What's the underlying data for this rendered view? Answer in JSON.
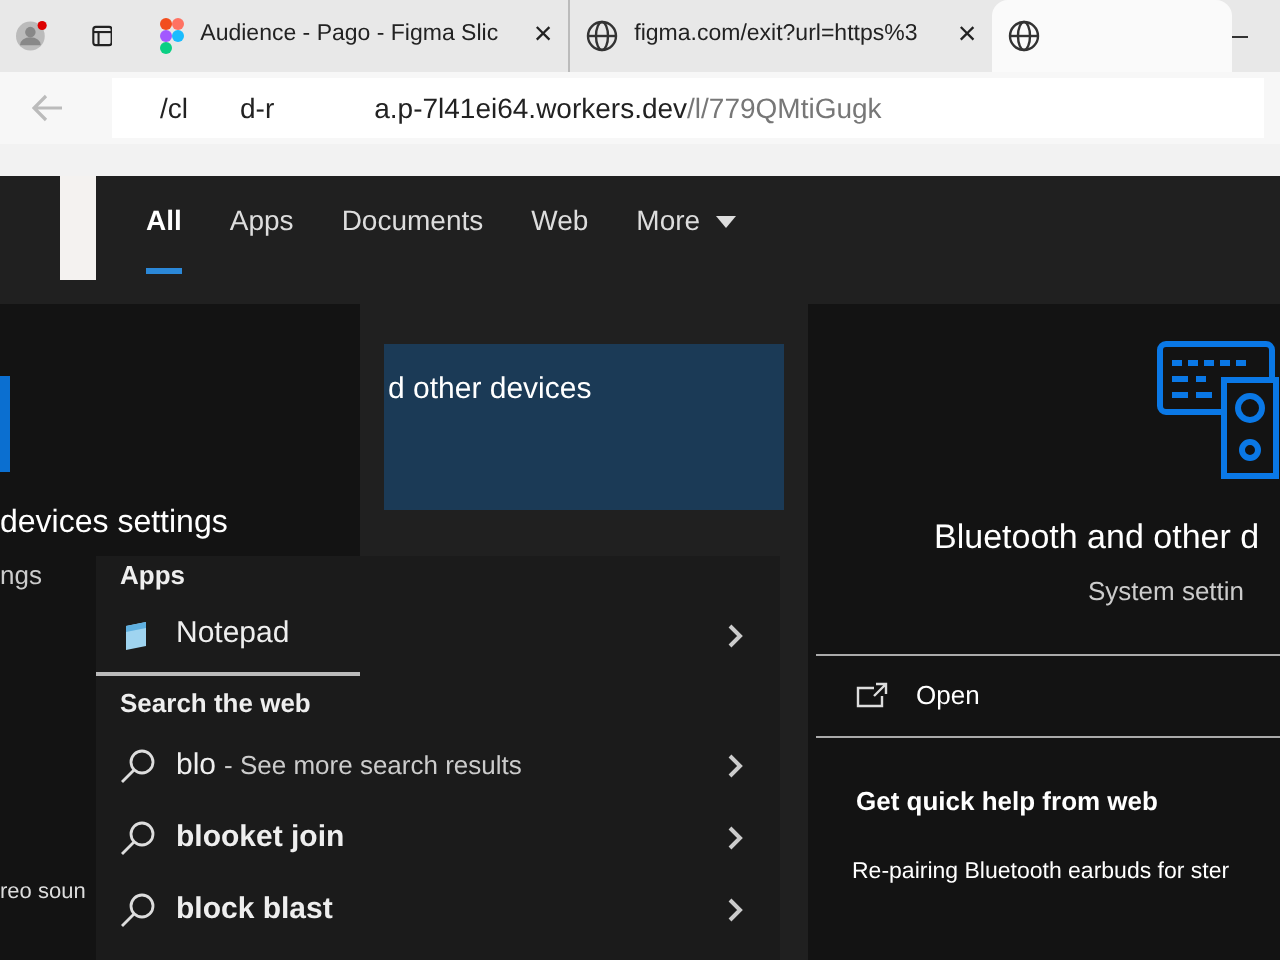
{
  "browser": {
    "tabs": [
      {
        "kind": "figma",
        "title": "Audience - Pago - Figma Slic",
        "close": "×",
        "selected": false
      },
      {
        "kind": "globe",
        "title": "figma.com/exit?url=https%3",
        "close": "×",
        "selected": false
      },
      {
        "kind": "globe",
        "selected": true
      }
    ],
    "address_bar": {
      "fragments": [
        "/cl",
        "d-r"
      ],
      "host": "a.p-7l41ei64.workers.dev",
      "path": "/l/779QMtiGugk"
    }
  },
  "search_tabs": [
    {
      "label": "All",
      "selected": true,
      "kind": "tab"
    },
    {
      "label": "Apps",
      "selected": false,
      "kind": "tab"
    },
    {
      "label": "Documents",
      "selected": false,
      "kind": "tab"
    },
    {
      "label": "Web",
      "selected": false,
      "kind": "tab"
    },
    {
      "label": "More",
      "selected": false,
      "kind": "menu"
    }
  ],
  "left_panel": {
    "title": "devices settings",
    "subtitle": "ngs",
    "item": "reo soun"
  },
  "highlight_card": {
    "title": "d other devices"
  },
  "results": [
    {
      "heading": "Apps",
      "items": [
        {
          "kind": "app",
          "label": "Notepad"
        }
      ]
    },
    {
      "heading": "Search the web",
      "items": [
        {
          "kind": "web",
          "label": "blo",
          "suffix": "- See more search results"
        },
        {
          "kind": "web",
          "label": "blooket join"
        },
        {
          "kind": "web",
          "label": "block blast"
        }
      ]
    }
  ],
  "detail": {
    "title": "Bluetooth and other d",
    "subtitle": "System settin",
    "actions": [
      {
        "label": "Open"
      }
    ],
    "help_heading": "Get quick help from web",
    "help_links": [
      "Re-pairing Bluetooth earbuds for ster"
    ]
  }
}
